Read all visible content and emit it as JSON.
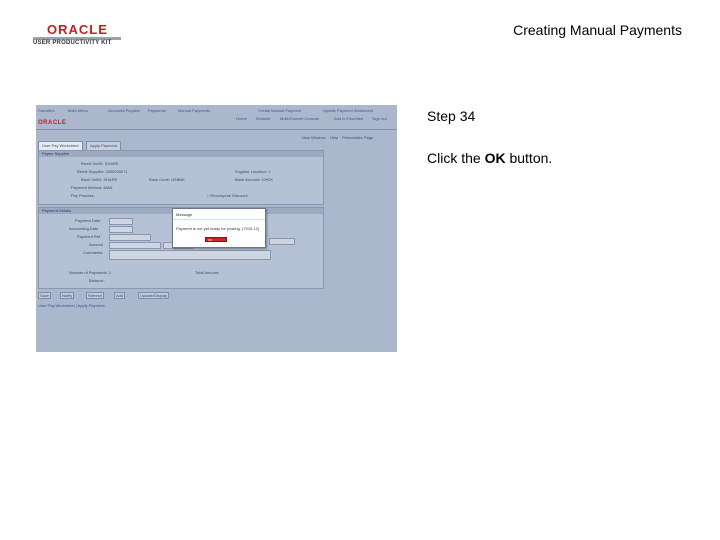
{
  "slide": {
    "title": "Creating Manual Payments",
    "step": "Step 34",
    "instruction_prefix": "Click the ",
    "instruction_bold": "OK",
    "instruction_suffix": " button."
  },
  "logo": {
    "brand": "ORACLE",
    "subtitle": "USER PRODUCTIVITY KIT"
  },
  "app": {
    "brand": "ORACLE",
    "top_nav": [
      "Favorites",
      "Main Menu",
      "Accounts Payable",
      "Payments",
      "Manual Payments",
      "Create Manual Payment",
      "Update Payment Worksheet"
    ],
    "header_links": [
      "Home",
      "Worklist",
      "MultiChannel Console",
      "Add to Favorites",
      "Sign out"
    ],
    "page_links": [
      "New Window",
      "Help",
      "Personalize Page"
    ],
    "tabs": [
      "User Pay Worksheet",
      "Apply Payment"
    ],
    "payee_panel": {
      "title": "Payee Supplier",
      "fields": [
        {
          "label": "Remit SetID",
          "value": "SHARE"
        },
        {
          "label": "Remit Supplier",
          "value": "0000000071"
        },
        {
          "label": "Bank SetID",
          "value": "SHARE"
        },
        {
          "label": "Payment Method",
          "value": "MAN"
        },
        {
          "label": "Pay Process",
          "value": ""
        },
        {
          "label": "Supplier Location",
          "value": "1"
        },
        {
          "label": "Bank Code",
          "value": "USBNK"
        },
        {
          "label": "Bank Account",
          "value": "CHCK"
        },
        {
          "label": "Recompute Discount",
          "value": ""
        }
      ]
    },
    "payment_panel": {
      "title": "Payment Details",
      "fields": [
        {
          "label": "Payment Date",
          "value": ""
        },
        {
          "label": "Accounting Date",
          "value": ""
        },
        {
          "label": "Payment Ref",
          "value": ""
        },
        {
          "label": "Amount",
          "value": ""
        },
        {
          "label": "Comments",
          "value": ""
        },
        {
          "label": "Number of Payments",
          "value": "1"
        },
        {
          "label": "Total Amount",
          "value": ""
        },
        {
          "label": "Balance",
          "value": ""
        }
      ]
    },
    "bottom_buttons": [
      "Save",
      "Notify",
      "Refresh",
      "Add",
      "Update/Display"
    ],
    "footer_links": "User Pay Worksheet | Apply Payment"
  },
  "modal": {
    "title": "Message",
    "text": "Payment is not yet ready for posting. (7010,12)",
    "ok_label": "OK"
  },
  "colors": {
    "oracle_red": "#c81e1e",
    "screenshot_bg": "#aab7cd",
    "ok_button": "#cc2525"
  }
}
